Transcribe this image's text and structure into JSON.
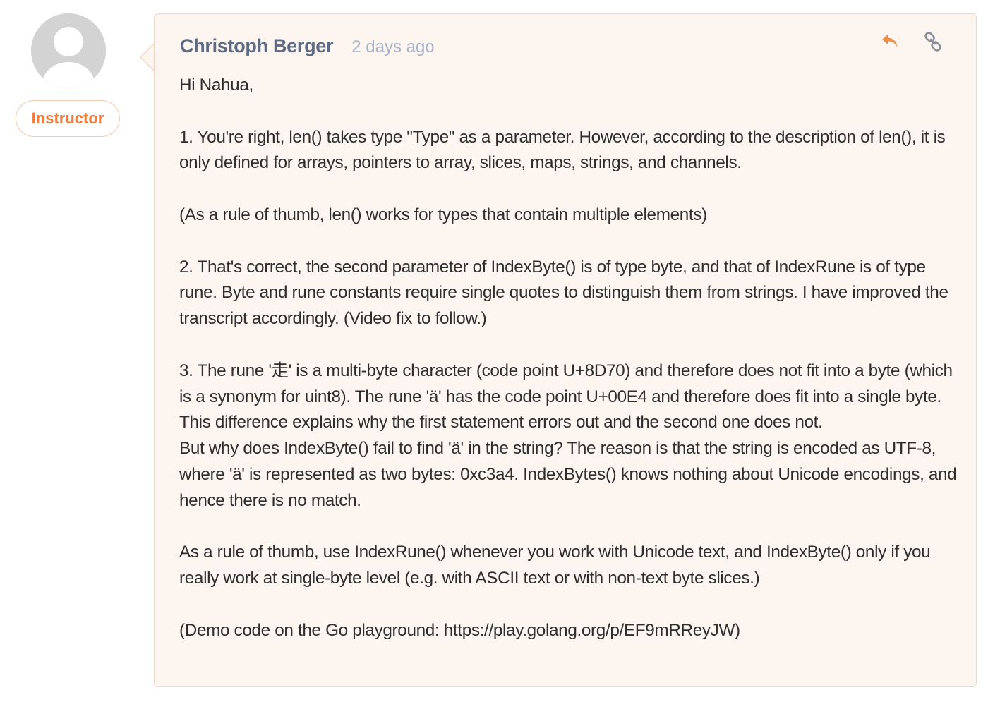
{
  "author": {
    "name": "Christoph Berger",
    "role": "Instructor",
    "avatar_icon": "default-user-avatar-icon"
  },
  "comment": {
    "timestamp": "2 days ago",
    "actions": {
      "reply_icon": "reply-arrow-icon",
      "link_icon": "chain-link-icon"
    },
    "paragraphs": [
      "Hi Nahua,",
      "1. You're right, len() takes type \"Type\" as a parameter. However, according to the description of len(), it is only defined for arrays, pointers to array, slices, maps, strings, and channels.",
      "(As a rule of thumb, len() works for types that contain multiple elements)",
      "2. That's correct, the second parameter of IndexByte() is of type byte, and that of IndexRune is of type rune. Byte and rune constants require single quotes to distinguish them from strings. I have improved the transcript accordingly. (Video fix to follow.)",
      "3. The rune '走' is a multi-byte character (code point U+8D70) and therefore does not fit into a byte (which is a synonym for uint8). The rune 'ä' has the code point U+00E4 and therefore does fit into a single byte. This difference explains why the first statement errors out and the second one does not.",
      "But why does IndexByte() fail to find 'ä' in the string? The reason is that the string is encoded as UTF-8, where 'ä' is represented as two bytes: 0xc3a4. IndexBytes() knows nothing about Unicode encodings, and hence there is no match.",
      "As a rule of thumb, use IndexRune() whenever you work with Unicode text, and IndexByte() only if you really work at single-byte level (e.g. with ASCII text or with non-text byte slices.)",
      "(Demo code on the Go playground: https://play.golang.org/p/EF9mRReyJW)"
    ]
  },
  "colors": {
    "card_background": "#fdf5f0",
    "card_border": "#f0d6c4",
    "author_name": "#5d6b85",
    "timestamp": "#a9b3c7",
    "accent_orange": "#ef7b3c",
    "link_icon_gray": "#8a8f99"
  }
}
